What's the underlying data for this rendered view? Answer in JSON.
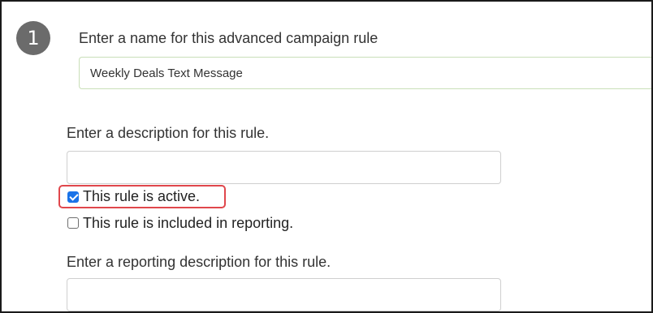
{
  "step": {
    "number": "1"
  },
  "rule_name": {
    "label": "Enter a name for this advanced campaign rule",
    "value": "Weekly Deals Text Message"
  },
  "description": {
    "label": "Enter a description for this rule.",
    "value": ""
  },
  "active_checkbox": {
    "label": "This rule is active.",
    "checked": true,
    "highlight_color": "#e0474c"
  },
  "reporting_checkbox": {
    "label": "This rule is included in reporting.",
    "checked": false
  },
  "reporting_description": {
    "label": "Enter a reporting description for this rule.",
    "value": ""
  },
  "colors": {
    "checkbox_accent": "#1a73e8",
    "step_badge": "#6b6b6b"
  }
}
